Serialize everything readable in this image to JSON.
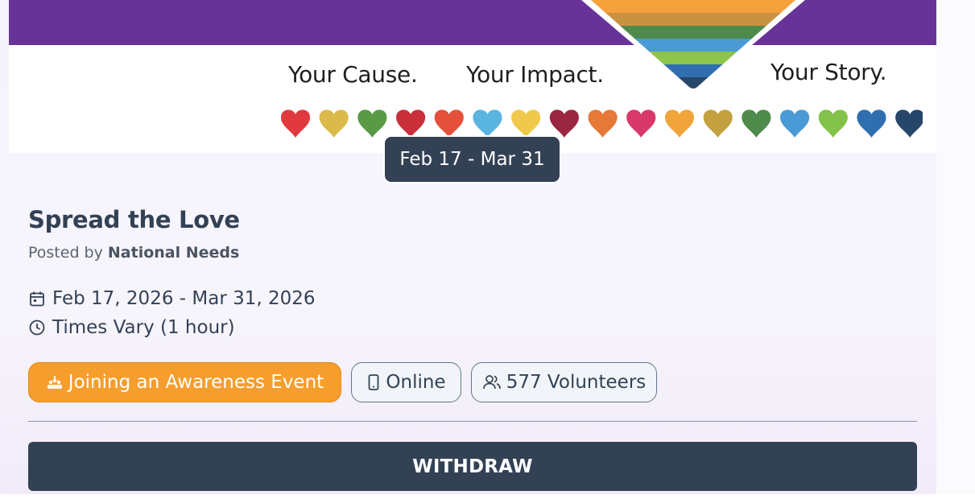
{
  "banner": {
    "taglines": [
      "Your Cause.",
      "Your Impact.",
      "Your Story."
    ],
    "band_color": "#673399",
    "stripe_colors": [
      "#f4a13c",
      "#c99243",
      "#4e8a4a",
      "#4a9ad6",
      "#8cc54a",
      "#2f6fb0",
      "#26466a"
    ],
    "heart_colors": [
      "#e0393e",
      "#dbb94a",
      "#5a9a47",
      "#c9303a",
      "#e4503a",
      "#5ab4e0",
      "#f0c84a",
      "#9b2641",
      "#e67838",
      "#d9386a",
      "#f0a43a",
      "#c2a13e",
      "#4e8a4a",
      "#4a9ad6",
      "#82c24a",
      "#2f6fb0",
      "#26466a"
    ],
    "date_pill": "Feb 17 - Mar 31"
  },
  "event": {
    "title": "Spread the Love",
    "posted_by_prefix": "Posted by ",
    "organizer": "National Needs",
    "date_range": "Feb 17, 2026 - Mar 31, 2026",
    "time": "Times Vary (1 hour)"
  },
  "tags": {
    "category": "Joining an Awareness Event",
    "category_color": "#f59e2e",
    "location": "Online",
    "volunteers": "577 Volunteers"
  },
  "actions": {
    "withdraw_label": "WITHDRAW"
  },
  "icons": [
    "calendar-icon",
    "clock-icon",
    "awareness-icon",
    "phone-icon",
    "users-icon"
  ]
}
